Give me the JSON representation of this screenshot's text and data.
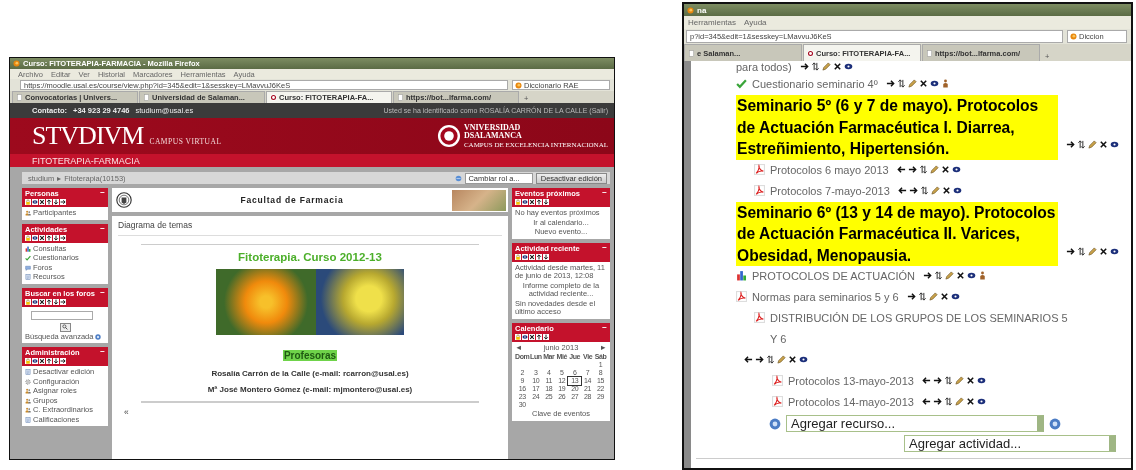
{
  "left_window": {
    "title": "Curso: FITOTERAPIA-FARMACIA - Mozilla Firefox",
    "menu": [
      "Archivo",
      "Editar",
      "Ver",
      "Historial",
      "Marcadores",
      "Herramientas",
      "Ayuda"
    ],
    "url": "https://moodle.usal.es/course/view.php?id=345&edit=1&sesskey=LMavvuJ6KeS",
    "search": "Diccionario RAE",
    "tabs": [
      {
        "label": "Convocatorias | Univers...",
        "selected": false
      },
      {
        "label": "Universidad de Salaman...",
        "selected": false
      },
      {
        "label": "Curso: FITOTERAPIA-FA...",
        "selected": true
      },
      {
        "label": "https://bot...lfarma.com/",
        "selected": false
      }
    ],
    "new_tab": "+",
    "contact": {
      "label": "Contacto:",
      "phone": "+34 923 29 4746",
      "email": "studium@usal.es"
    },
    "login": "Usted se ha identificado como ROSALÍA CARRÓN DE LA CALLE (Salir)",
    "brand": {
      "logo": "STVDIVM",
      "subtitle": "CAMPUS VIRTUAL",
      "course": "FITOTERAPIA-FARMACIA",
      "university": [
        "VNIVERSIDAD",
        "DSALAMANCA"
      ],
      "tagline": "CAMPUS DE EXCELENCIA INTERNACIONAL"
    },
    "breadcrumb": [
      "studium",
      "▸",
      "Fitoterapia(10153)"
    ],
    "role_select": "Cambiar rol a...",
    "edit_button": "Desactivar edición",
    "left_blocks": [
      {
        "kind": "links",
        "title": "Personas",
        "collapse": "−",
        "items": [
          {
            "kind": "people",
            "label": "Participantes"
          }
        ]
      },
      {
        "kind": "links",
        "title": "Actividades",
        "collapse": "−",
        "items": [
          {
            "kind": "choice",
            "label": "Consultas"
          },
          {
            "kind": "quiz",
            "label": "Cuestionarios"
          },
          {
            "kind": "forum",
            "label": "Foros"
          },
          {
            "kind": "resource",
            "label": "Recursos"
          }
        ]
      },
      {
        "kind": "search",
        "title": "Buscar en los foros",
        "collapse": "−",
        "advanced": "Búsqueda avanzada"
      },
      {
        "kind": "links",
        "title": "Administración",
        "collapse": "−",
        "items": [
          {
            "kind": "resource",
            "label": "Desactivar edición"
          },
          {
            "kind": "settings",
            "label": "Configuración"
          },
          {
            "kind": "people",
            "label": "Asignar roles"
          },
          {
            "kind": "people",
            "label": "Grupos"
          },
          {
            "kind": "people",
            "label": "C. Extraordinarios"
          },
          {
            "kind": "resource",
            "label": "Calificaciones"
          }
        ]
      }
    ],
    "course_header": "Facultad de Farmacia",
    "section_title": "Diagrama de temas",
    "course_title": "Fitoterapia. Curso 2012-13",
    "teachers_heading": "Profesoras",
    "teachers": [
      "Rosalía Carrón de la Calle (e-mail: rcarron@usal.es)",
      "Mª José Montero Gómez (e-mail: mjmontero@usal.es)"
    ],
    "collapse_link": "«",
    "right_blocks": [
      {
        "title": "Eventos próximos",
        "collapse": "−",
        "text": [
          "No hay eventos próximos"
        ],
        "links": [
          "Ir al calendario...",
          "Nuevo evento..."
        ]
      },
      {
        "title": "Actividad reciente",
        "collapse": "−",
        "text": [
          "Actividad desde martes, 11 de junio de 2013, 12:08"
        ],
        "links": [
          "Informe completo de la actividad reciente..."
        ],
        "note": "Sin novedades desde el último acceso"
      },
      {
        "title": "Calendario",
        "collapse": "−",
        "calendar": {
          "prev": "◄",
          "month": "junio 2013",
          "next": "►",
          "weekdays": [
            "Dom",
            "Lun",
            "Mar",
            "Mié",
            "Jue",
            "Vie",
            "Sáb"
          ],
          "weeks": [
            [
              {
                "day": "1",
                "today": false
              }
            ],
            [
              {
                "day": "2",
                "today": false
              },
              {
                "day": "3",
                "today": false
              },
              {
                "day": "4",
                "today": false
              },
              {
                "day": "5",
                "today": false
              },
              {
                "day": "6",
                "today": false
              },
              {
                "day": "7",
                "today": false
              },
              {
                "day": "8",
                "today": false
              }
            ],
            [
              {
                "day": "9",
                "today": false
              },
              {
                "day": "10",
                "today": false
              },
              {
                "day": "11",
                "today": false
              },
              {
                "day": "12",
                "today": false
              },
              {
                "day": "13",
                "today": true
              },
              {
                "day": "14",
                "today": false
              },
              {
                "day": "15",
                "today": false
              }
            ],
            [
              {
                "day": "16",
                "today": false
              },
              {
                "day": "17",
                "today": false
              },
              {
                "day": "18",
                "today": false
              },
              {
                "day": "19",
                "today": false
              },
              {
                "day": "20",
                "today": false
              },
              {
                "day": "21",
                "today": false
              },
              {
                "day": "22",
                "today": false
              }
            ],
            [
              {
                "day": "23",
                "today": false
              },
              {
                "day": "24",
                "today": false
              },
              {
                "day": "25",
                "today": false
              },
              {
                "day": "26",
                "today": false
              },
              {
                "day": "27",
                "today": false
              },
              {
                "day": "28",
                "today": false
              },
              {
                "day": "29",
                "today": false
              }
            ],
            [
              {
                "day": "30",
                "today": false
              }
            ]
          ]
        },
        "links": [
          "Clave de eventos"
        ]
      }
    ]
  },
  "right_window": {
    "title": "na",
    "menu": [
      "Herramientas",
      "Ayuda"
    ],
    "url": "p?id=345&edit=1&sesskey=LMavvuJ6KeS",
    "search": "Diccion",
    "tabs": [
      {
        "label": "e Salaman...",
        "selected": false
      },
      {
        "label": "Curso: FITOTERAPIA-FA...",
        "selected": true
      },
      {
        "label": "https://bot...lfarma.com/",
        "selected": false
      }
    ],
    "new_tab": "+",
    "items": [
      {
        "kind": "text",
        "label": "para todos)"
      },
      {
        "kind": "quiz",
        "label": "Cuestionario seminario 4º"
      },
      {
        "kind": "heading",
        "label": "Seminario 5º (6 y 7 de mayo). Protocolos de Actuación Farmacéutica I. Diarrea, Estreñimiento, Hipertensión.",
        "children": [
          {
            "kind": "file",
            "label": "Protocolos 6 mayo 2013"
          },
          {
            "kind": "file",
            "label": "Protocolos 7-mayo-2013"
          }
        ]
      },
      {
        "kind": "heading",
        "label": "Seminario 6º (13 y 14 de mayo). Protocolos de Actuación Farmacéutica II. Varices, Obesidad, Menopausia."
      },
      {
        "kind": "choice",
        "label": "PROTOCOLOS DE ACTUACIÓN"
      },
      {
        "kind": "file",
        "label": "Normas para seminarios 5 y 6",
        "children": [
          {
            "kind": "file",
            "label": "DISTRIBUCIÓN DE LOS GRUPOS DE LOS SEMINARIOS 5 Y 6",
            "children": [
              {
                "kind": "file",
                "label": "Protocolos 13-mayo-2013"
              },
              {
                "kind": "file",
                "label": "Protocolos 14-mayo-2013"
              }
            ]
          }
        ]
      }
    ],
    "add_resource": "Agregar recurso...",
    "add_activity": "Agregar actividad..."
  }
}
